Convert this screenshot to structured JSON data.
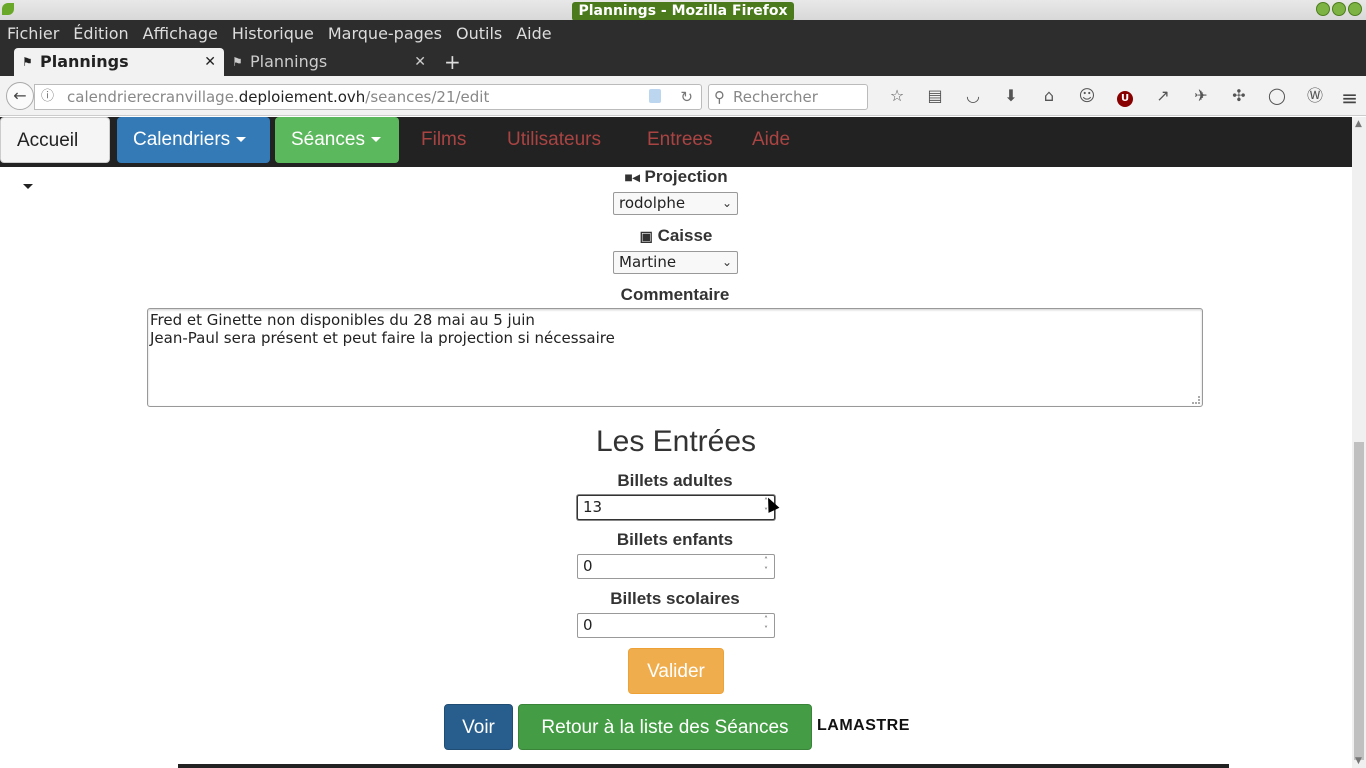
{
  "window": {
    "title": "Plannings - Mozilla Firefox"
  },
  "menubar": {
    "items": [
      "Fichier",
      "Édition",
      "Affichage",
      "Historique",
      "Marque-pages",
      "Outils",
      "Aide"
    ]
  },
  "tabs": [
    {
      "label": "Plannings",
      "active": true
    },
    {
      "label": "Plannings",
      "active": false
    }
  ],
  "nav": {
    "url_prefix": "calendrierecranvillage.",
    "url_domain": "deploiement.ovh",
    "url_path": "/seances/21/edit",
    "search_placeholder": "Rechercher"
  },
  "appnav": {
    "accueil": "Accueil",
    "calendriers": "Calendriers",
    "seances": "Séances",
    "links": [
      "Films",
      "Utilisateurs",
      "Entrees",
      "Aide"
    ]
  },
  "form": {
    "projection_label": "Projection",
    "projection_value": "rodolphe",
    "caisse_label": "Caisse",
    "caisse_value": "Martine",
    "commentaire_label": "Commentaire",
    "commentaire_lines": [
      "Fred et Ginette non disponibles du 28 mai au 5 juin",
      "Jean-Paul sera présent et peut faire la projection si nécessaire"
    ],
    "entrees_title": "Les Entrées",
    "adultes_label": "Billets adultes",
    "adultes_value": "13",
    "enfants_label": "Billets enfants",
    "enfants_value": "0",
    "scolaires_label": "Billets scolaires",
    "scolaires_value": "0",
    "valider": "Valider",
    "voir": "Voir",
    "retour": "Retour à la liste des Séances",
    "city": "LAMASTRE"
  },
  "colors": {
    "primary": "#337ab7",
    "success": "#5cb85c",
    "warning": "#f0ad4e",
    "danger_link": "#a94442"
  }
}
